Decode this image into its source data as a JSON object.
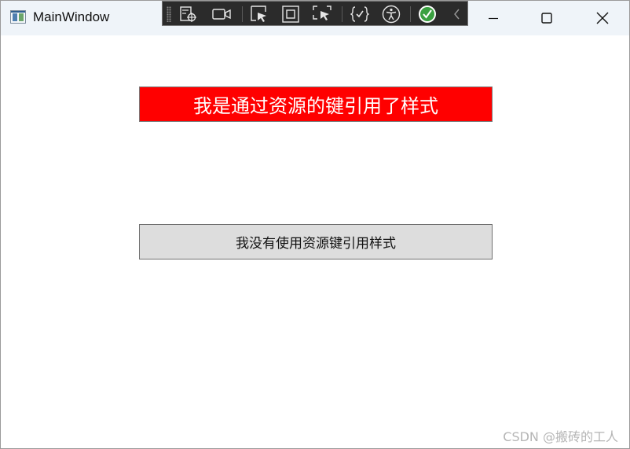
{
  "window": {
    "title": "MainWindow"
  },
  "buttons": {
    "styled_label": "我是通过资源的键引用了样式",
    "plain_label": "我没有使用资源键引用样式"
  },
  "watermark": "CSDN @搬砖的工人",
  "colors": {
    "titlebar_bg": "#eff4f9",
    "styled_button_bg": "#ff0000",
    "styled_button_fg": "#ffffff",
    "plain_button_bg": "#dddddd",
    "devbar_bg": "#2b2b2b",
    "check_green": "#3aa040"
  },
  "devtools": {
    "items": [
      "live-visual-tree-icon",
      "video-camera-icon",
      "select-element-icon",
      "display-layout-adorners-icon",
      "track-focus-icon",
      "binding-failures-icon",
      "accessibility-icon",
      "check-circle-icon",
      "collapse-chevron-icon"
    ]
  }
}
